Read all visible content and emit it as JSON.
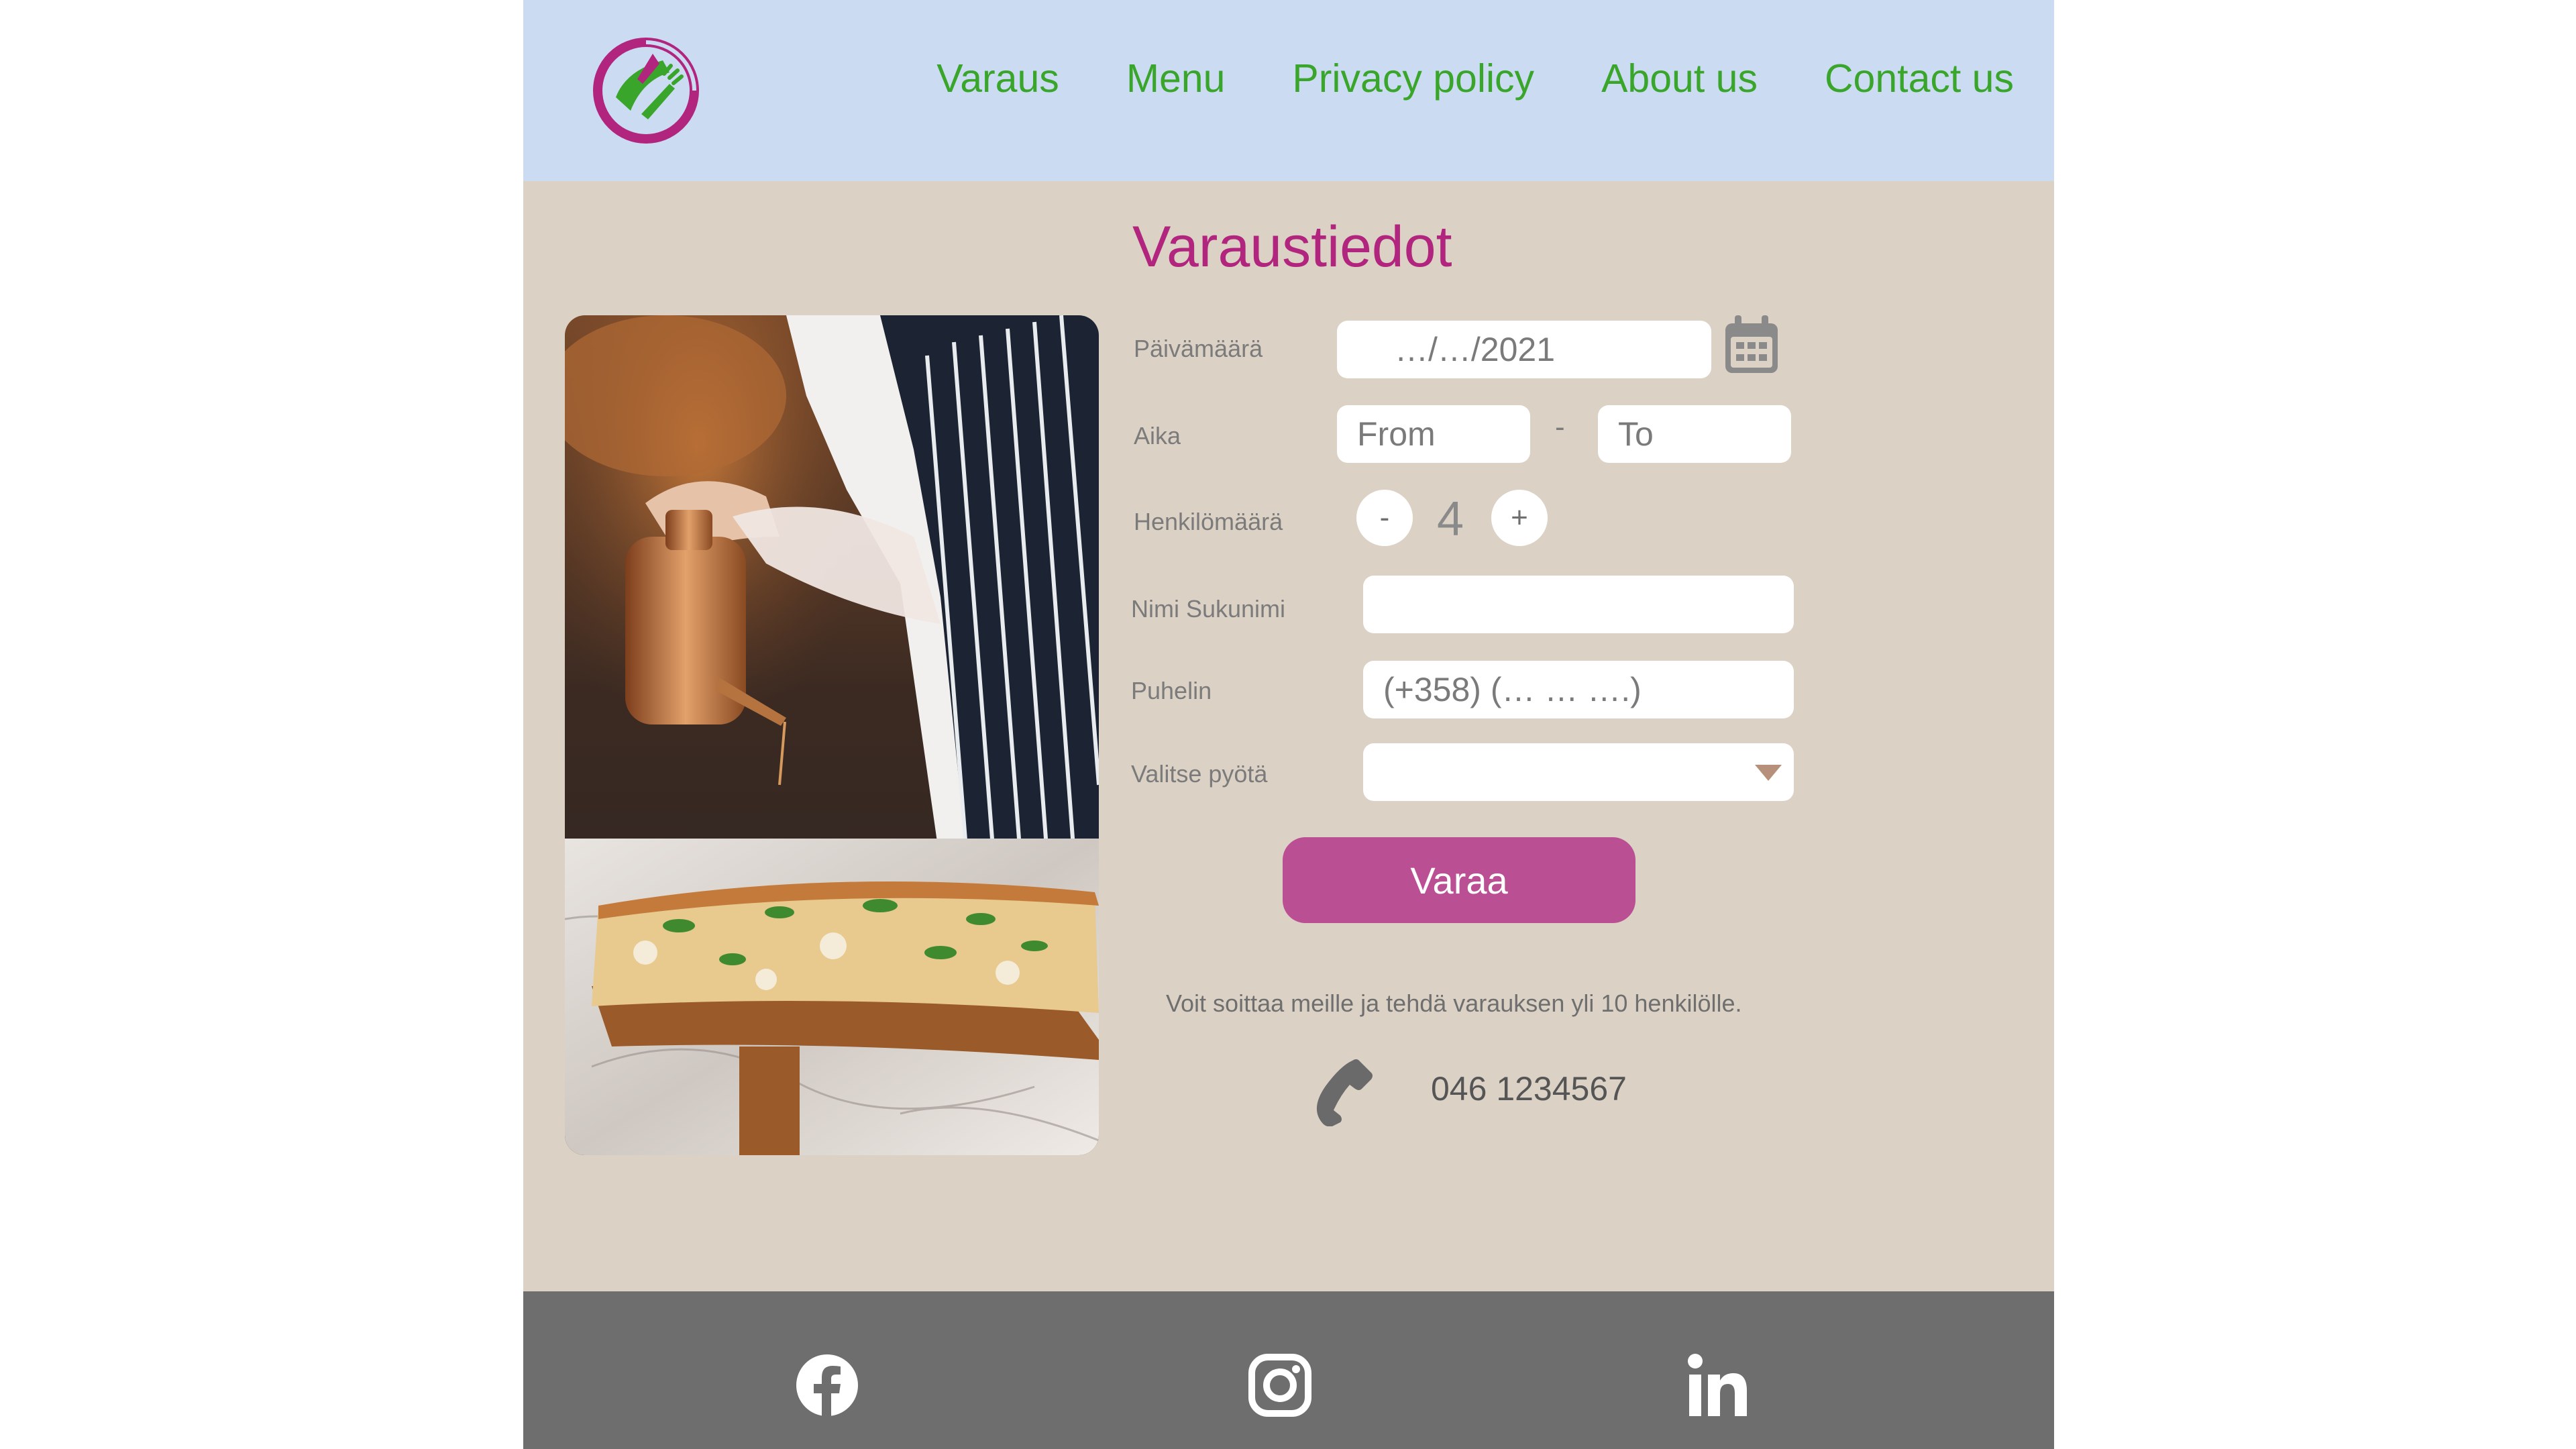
{
  "nav": {
    "items": [
      "Varaus",
      "Menu",
      "Privacy policy",
      "About us",
      "Contact us"
    ]
  },
  "form": {
    "title": "Varaustiedot",
    "date": {
      "label": "Päivämäärä",
      "value": "…/…/2021"
    },
    "time": {
      "label": "Aika",
      "from_placeholder": "From",
      "separator": "-",
      "to_placeholder": "To"
    },
    "people": {
      "label": "Henkilömäärä",
      "minus": "-",
      "count": "4",
      "plus": "+"
    },
    "name": {
      "label": "Nimi Sukunimi",
      "value": ""
    },
    "phone": {
      "label": "Puhelin",
      "placeholder": "(+358) (… … ….)"
    },
    "table": {
      "label": "Valitse pyötä",
      "value": ""
    },
    "submit_label": "Varaa"
  },
  "contact": {
    "note": "Voit soittaa meille ja tehdä varauksen yli 10 henkilölle.",
    "phone_number": "046 1234567"
  },
  "icons": {
    "logo": "restaurant-logo-icon",
    "calendar": "calendar-icon",
    "phone": "phone-icon",
    "social": [
      "facebook-icon",
      "instagram-icon",
      "linkedin-icon"
    ]
  },
  "colors": {
    "header_bg": "#cbdcf2",
    "nav_text": "#3aa52b",
    "page_bg": "#dbd1c4",
    "title": "#b1257e",
    "button": "#ba4f94",
    "footer_bg": "#6e6e6e"
  }
}
